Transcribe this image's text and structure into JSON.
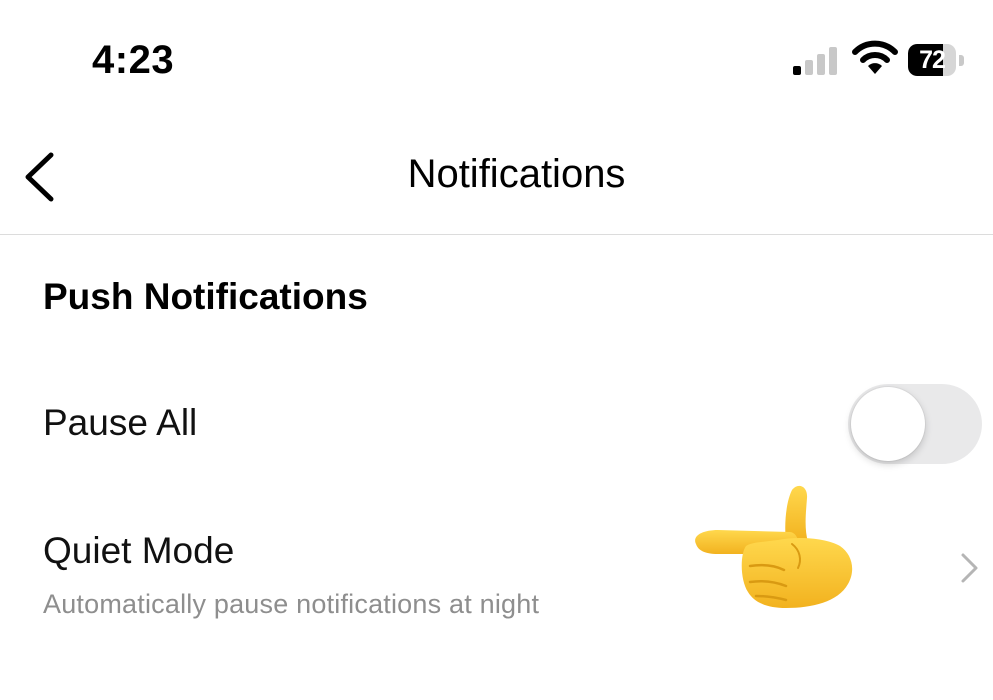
{
  "status_bar": {
    "time": "4:23",
    "battery_level": "72",
    "battery_fraction": 0.72,
    "icons": [
      "cellular-signal-icon",
      "wifi-icon",
      "battery-icon"
    ]
  },
  "header": {
    "title": "Notifications",
    "back_icon": "chevron-left-icon"
  },
  "section": {
    "title": "Push Notifications"
  },
  "rows": {
    "pause_all": {
      "label": "Pause All",
      "toggle_on": false
    },
    "quiet_mode": {
      "label": "Quiet Mode",
      "subtitle": "Automatically pause notifications at night",
      "icon": "chevron-right-icon"
    }
  },
  "overlay": {
    "icon": "pointing-hand-emoji-icon"
  },
  "colors": {
    "toggle_off": "#e9e9ea",
    "subtitle": "#8e8e8e",
    "divider": "#dcdcdc",
    "emoji_yellow": "#f7c531"
  }
}
